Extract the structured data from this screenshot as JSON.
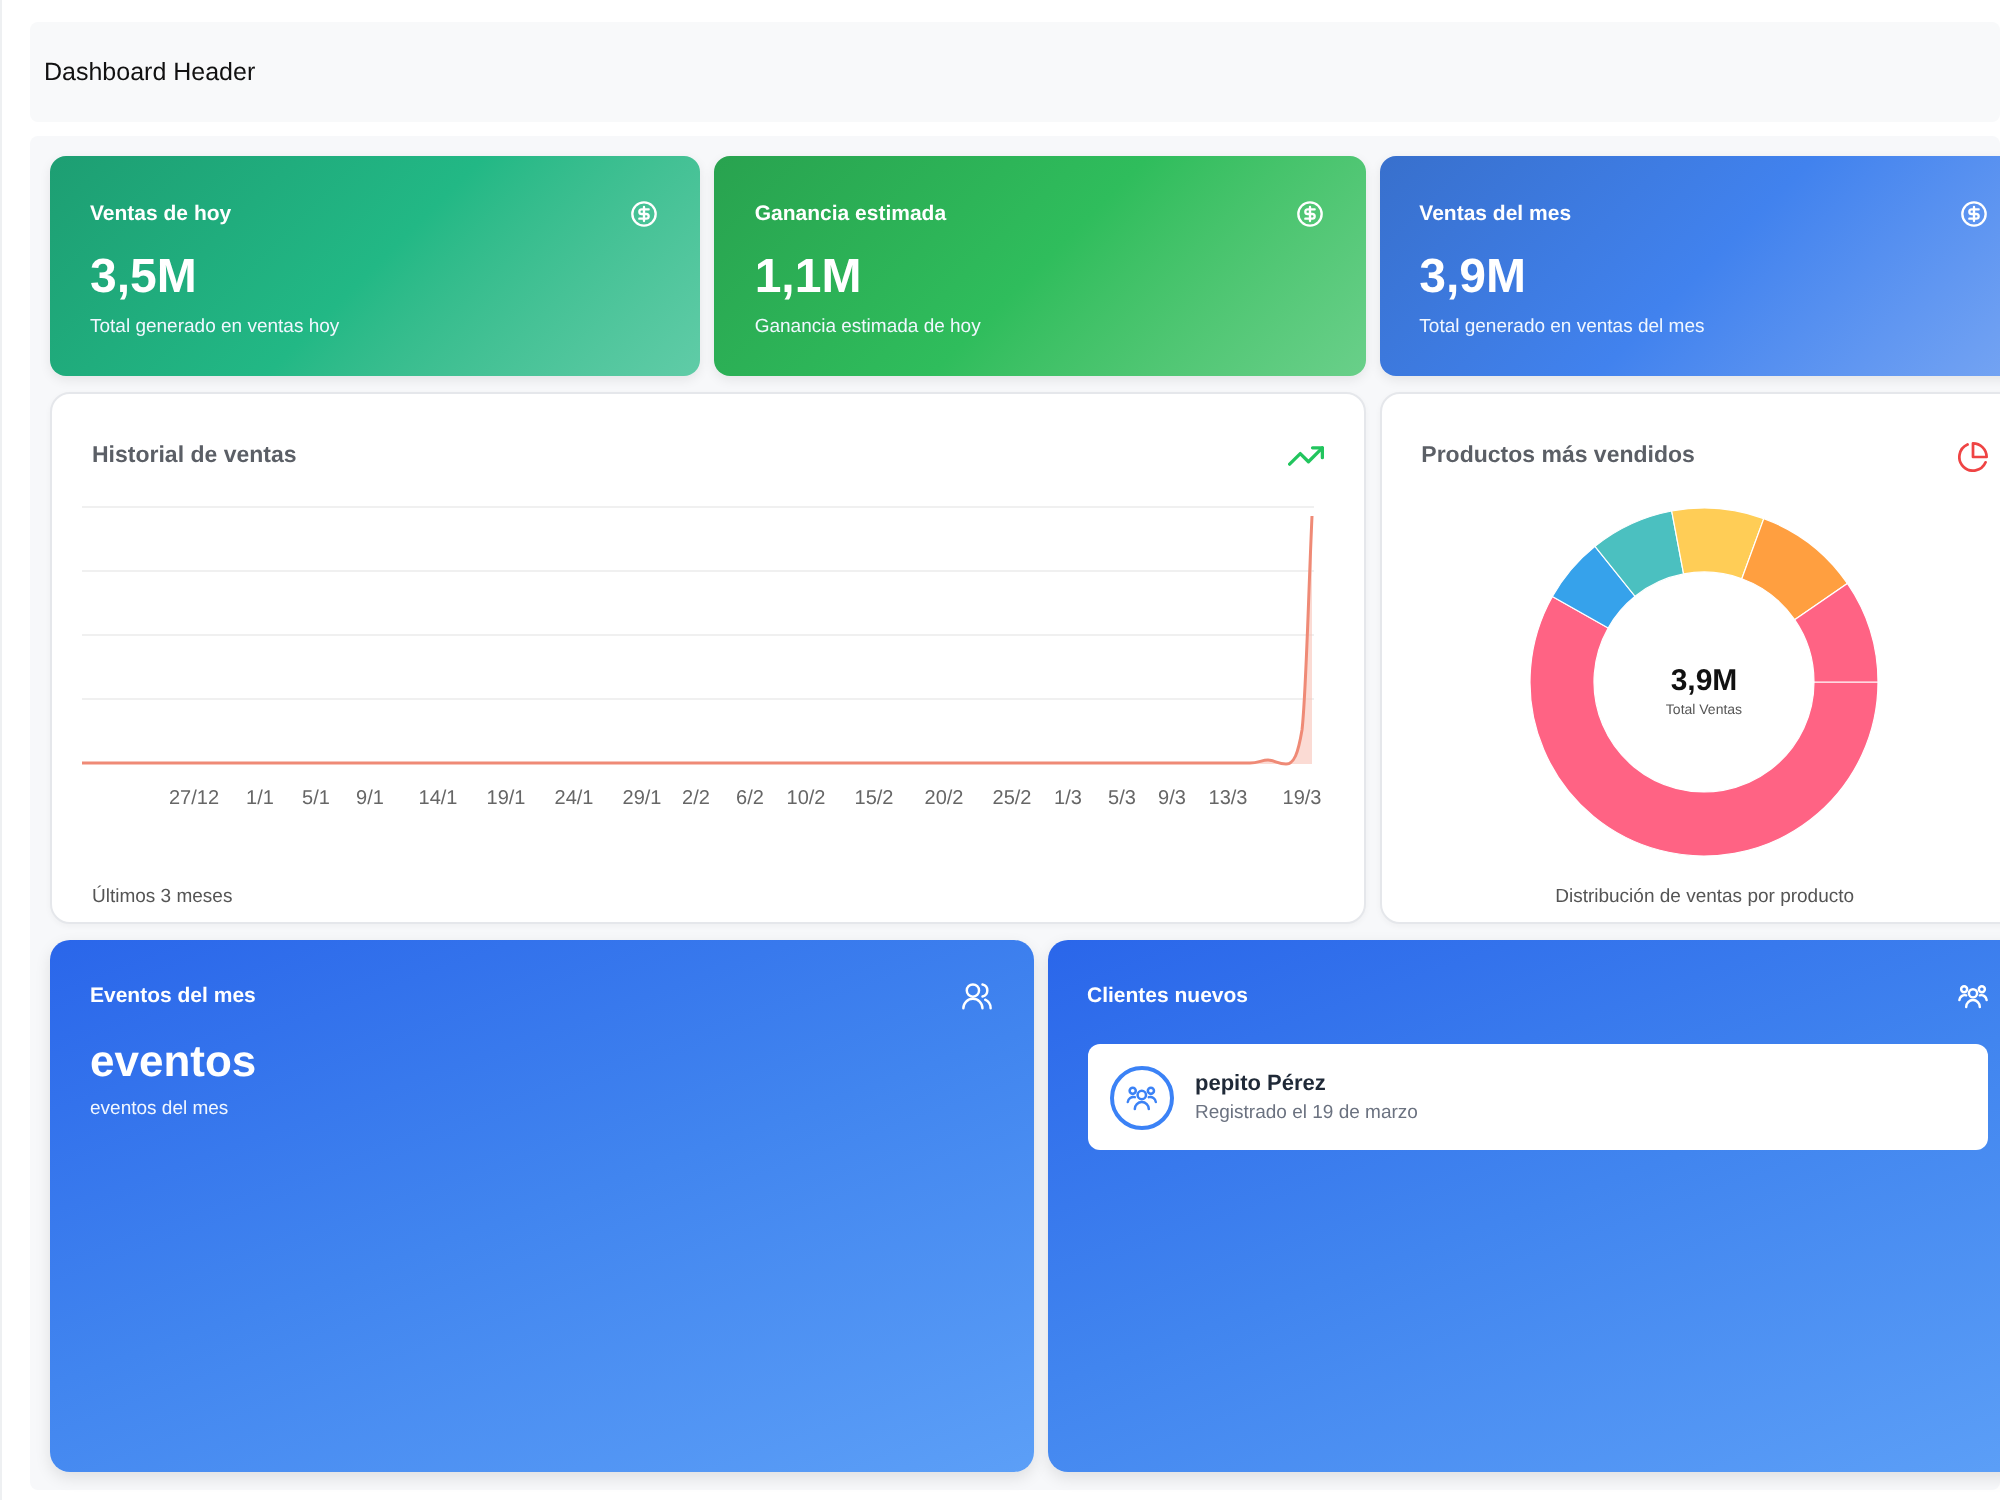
{
  "header": {
    "title": "Dashboard Header"
  },
  "stat_cards": [
    {
      "title": "Ventas de hoy",
      "value": "3,5M",
      "caption": "Total generado en ventas hoy",
      "color": "#22b885"
    },
    {
      "title": "Ganancia estimada",
      "value": "1,1M",
      "caption": "Ganancia estimada de hoy",
      "color": "#2fbd5c"
    },
    {
      "title": "Ventas del mes",
      "value": "3,9M",
      "caption": "Total generado en ventas del mes",
      "color": "#4182ee"
    }
  ],
  "sales_history": {
    "title": "Historial de ventas",
    "x_labels": [
      "27/12",
      "1/1",
      "5/1",
      "9/1",
      "14/1",
      "19/1",
      "24/1",
      "29/1",
      "2/2",
      "6/2",
      "10/2",
      "15/2",
      "20/2",
      "25/2",
      "1/3",
      "5/3",
      "9/3",
      "13/3",
      "19/3"
    ],
    "footer": "Últimos 3 meses"
  },
  "top_products": {
    "title": "Productos más vendidos",
    "center_value": "3,9M",
    "center_label": "Total Ventas",
    "footer": "Distribución de ventas por producto"
  },
  "events": {
    "title": "Eventos del mes",
    "value": "eventos",
    "caption": "eventos del mes"
  },
  "new_clients": {
    "title": "Clientes nuevos",
    "clients": [
      {
        "name": "pepito Pérez",
        "registered": "Registrado el 19 de marzo"
      }
    ]
  }
}
